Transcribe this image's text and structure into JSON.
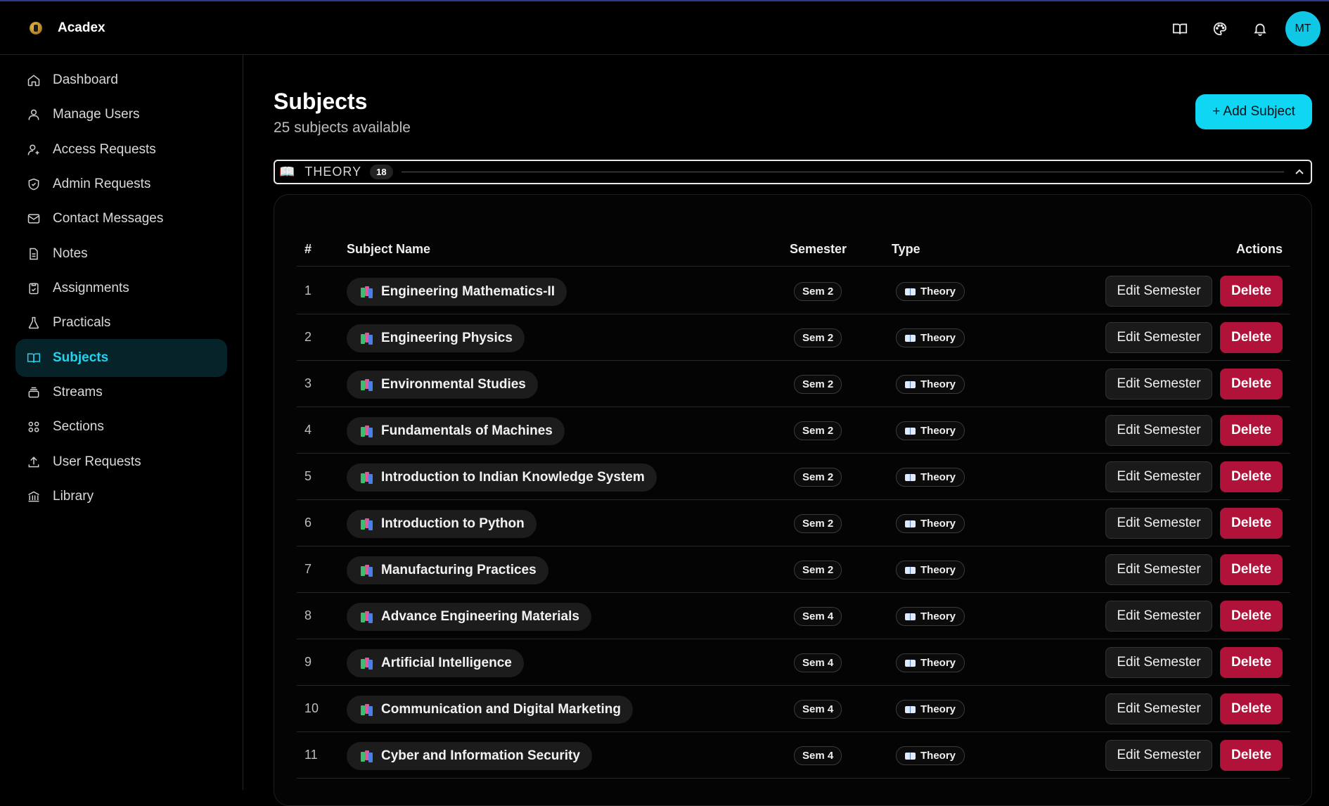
{
  "app": {
    "name": "Acadex",
    "avatar_initials": "MT"
  },
  "topbar_icons": [
    "book-icon",
    "palette-icon",
    "bell-icon"
  ],
  "sidebar": {
    "items": [
      {
        "label": "Dashboard",
        "icon": "home-icon",
        "active": false
      },
      {
        "label": "Manage Users",
        "icon": "users-icon",
        "active": false
      },
      {
        "label": "Access Requests",
        "icon": "user-plus-icon",
        "active": false
      },
      {
        "label": "Admin Requests",
        "icon": "shield-check-icon",
        "active": false
      },
      {
        "label": "Contact Messages",
        "icon": "mail-icon",
        "active": false
      },
      {
        "label": "Notes",
        "icon": "file-text-icon",
        "active": false
      },
      {
        "label": "Assignments",
        "icon": "clipboard-check-icon",
        "active": false
      },
      {
        "label": "Practicals",
        "icon": "flask-icon",
        "active": false
      },
      {
        "label": "Subjects",
        "icon": "book-open-icon",
        "active": true
      },
      {
        "label": "Streams",
        "icon": "layers-icon",
        "active": false
      },
      {
        "label": "Sections",
        "icon": "grid-icon",
        "active": false
      },
      {
        "label": "User Requests",
        "icon": "upload-icon",
        "active": false
      },
      {
        "label": "Library",
        "icon": "library-icon",
        "active": false
      }
    ],
    "accent": "#22d3ee"
  },
  "main": {
    "title": "Subjects",
    "subtitle": "25 subjects available",
    "add_button": "+ Add Subject",
    "group": {
      "label": "THEORY",
      "count": "18"
    },
    "table": {
      "headers": {
        "num": "#",
        "name": "Subject Name",
        "semester": "Semester",
        "type": "Type",
        "actions": "Actions"
      },
      "edit_label": "Edit Semester",
      "delete_label": "Delete",
      "rows": [
        {
          "num": "1",
          "name": "Engineering Mathematics-II",
          "semester": "Sem 2",
          "type": "Theory"
        },
        {
          "num": "2",
          "name": "Engineering Physics",
          "semester": "Sem 2",
          "type": "Theory"
        },
        {
          "num": "3",
          "name": "Environmental Studies",
          "semester": "Sem 2",
          "type": "Theory"
        },
        {
          "num": "4",
          "name": "Fundamentals of Machines",
          "semester": "Sem 2",
          "type": "Theory"
        },
        {
          "num": "5",
          "name": "Introduction to Indian Knowledge System",
          "semester": "Sem 2",
          "type": "Theory"
        },
        {
          "num": "6",
          "name": "Introduction to Python",
          "semester": "Sem 2",
          "type": "Theory"
        },
        {
          "num": "7",
          "name": "Manufacturing Practices",
          "semester": "Sem 2",
          "type": "Theory"
        },
        {
          "num": "8",
          "name": "Advance Engineering Materials",
          "semester": "Sem 4",
          "type": "Theory"
        },
        {
          "num": "9",
          "name": "Artificial Intelligence",
          "semester": "Sem 4",
          "type": "Theory"
        },
        {
          "num": "10",
          "name": "Communication and Digital Marketing",
          "semester": "Sem 4",
          "type": "Theory"
        },
        {
          "num": "11",
          "name": "Cyber and Information Security",
          "semester": "Sem 4",
          "type": "Theory"
        }
      ]
    }
  },
  "colors": {
    "add_button": "#0fd6f2",
    "delete_button": "#b0123a",
    "avatar": "#10c8e6"
  }
}
